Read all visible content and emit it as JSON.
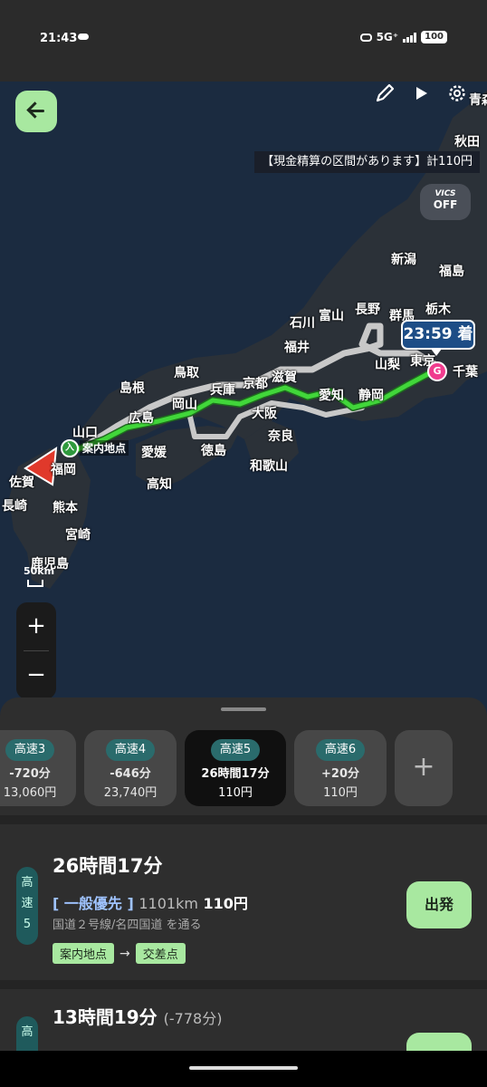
{
  "status_bar": {
    "time": "21:43",
    "network": "5G⁺",
    "battery": "100"
  },
  "map": {
    "notice": "【現金精算の区間があります】計110円",
    "vics": {
      "title": "VICS",
      "state": "OFF"
    },
    "places": [
      "秋田",
      "青森",
      "新潟",
      "福島",
      "栃木",
      "群馬",
      "長野",
      "富山",
      "石川",
      "福井",
      "山梨",
      "東京",
      "千葉",
      "鳥取",
      "島根",
      "兵庫",
      "京都",
      "滋賀",
      "愛知",
      "静岡",
      "岡山",
      "広島",
      "山口",
      "大阪",
      "奈良",
      "徳島",
      "愛媛",
      "高知",
      "和歌山",
      "佐賀",
      "福岡",
      "長崎",
      "熊本",
      "宮崎",
      "鹿児島"
    ],
    "eta": "23:59 着",
    "goal_marker": "G",
    "entry_marker": "入",
    "entry_label": "案内地点",
    "scale": "50km",
    "zoom_in": "+",
    "zoom_out": "−"
  },
  "route_options": [
    {
      "tag": "高速3",
      "time": "-720分",
      "cost": "13,060円"
    },
    {
      "tag": "高速4",
      "time": "-646分",
      "cost": "23,740円"
    },
    {
      "tag": "高速5",
      "time": "26時間17分",
      "cost": "110円",
      "selected": true
    },
    {
      "tag": "高速6",
      "time": "+20分",
      "cost": "110円"
    }
  ],
  "add_label": "+",
  "selected_route": {
    "pill": [
      "高",
      "速",
      "5"
    ],
    "time": "26時間17分",
    "mode": "[ 一般優先 ]",
    "distance": "1101km",
    "toll": "110円",
    "via": "国道２号線/名四国道 を通る",
    "chips": [
      "案内地点",
      "交差点"
    ],
    "go_label": "出発"
  },
  "next_route": {
    "pill": "高",
    "time": "13時間19分",
    "diff": "(-778分)"
  }
}
